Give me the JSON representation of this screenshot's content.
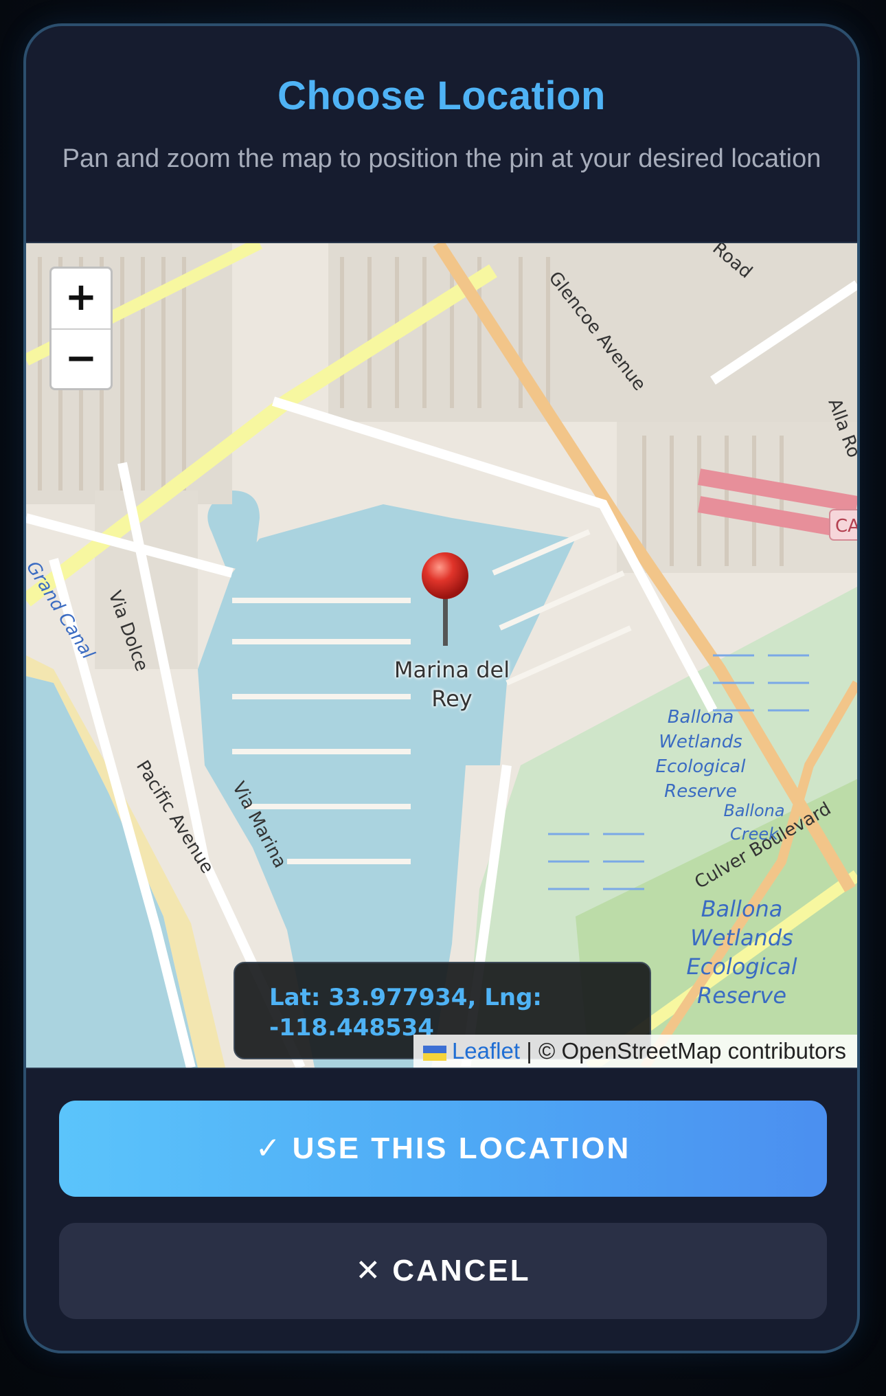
{
  "header": {
    "title": "Choose Location",
    "subtitle": "Pan and zoom the map to position the pin at your desired location"
  },
  "map": {
    "zoom_in_label": "+",
    "zoom_out_label": "−",
    "place_label_line1": "Marina del",
    "place_label_line2": "Rey",
    "labels": {
      "glencoe": "Glencoe Avenue",
      "road": "Road",
      "alla": "Alla Ro",
      "ca": "CA",
      "grand_canal": "Grand Canal",
      "via_dolce": "Via Dolce",
      "pacific": "Pacific Avenue",
      "via_marina": "Via Marina",
      "ballona1_l1": "Ballona",
      "ballona1_l2": "Wetlands",
      "ballona1_l3": "Ecological",
      "ballona1_l4": "Reserve",
      "creek_l1": "Ballona",
      "creek_l2": "Creek",
      "culver": "Culver Boulevard",
      "ballona2_l1": "Ballona",
      "ballona2_l2": "Wetlands",
      "ballona2_l3": "Ecological",
      "ballona2_l4": "Reserve"
    },
    "coordinates": {
      "line1": "Lat: 33.977934, Lng:",
      "line2": "-118.448534"
    },
    "attribution": {
      "leaflet": "Leaflet",
      "separator": " | ",
      "osm": "© OpenStreetMap contributors"
    }
  },
  "actions": {
    "confirm_icon": "✓",
    "confirm_label": "USE THIS LOCATION",
    "cancel_icon": "✕",
    "cancel_label": "CANCEL"
  },
  "colors": {
    "accent": "#4fb3f5",
    "modal_bg": "#161c2f",
    "cancel_bg": "#2a3046"
  }
}
